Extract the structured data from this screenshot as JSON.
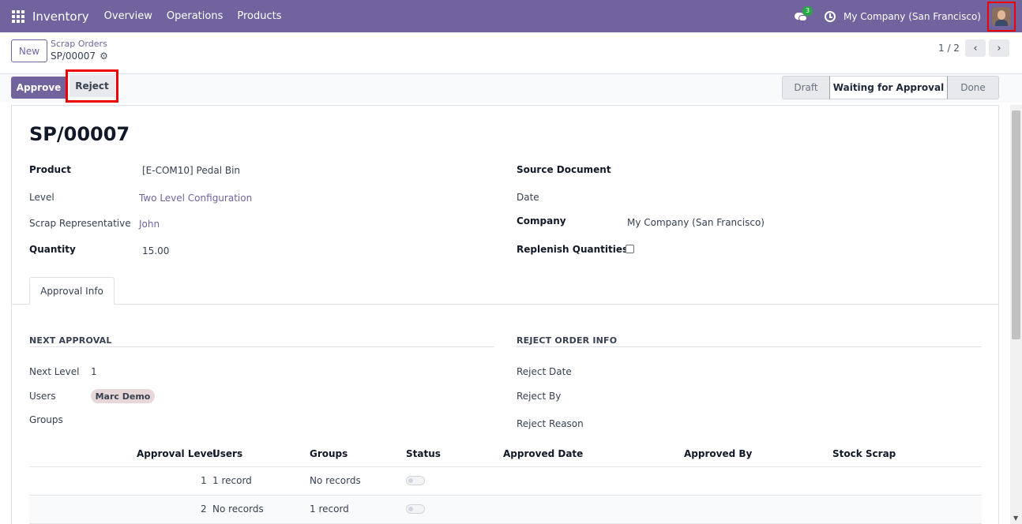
{
  "navbar": {
    "app_name": "Inventory",
    "menu": [
      "Overview",
      "Operations",
      "Products"
    ],
    "chat_badge": "3",
    "company": "My Company (San Francisco)",
    "color": "#71639e"
  },
  "control": {
    "new_label": "New",
    "breadcrumb_parent": "Scrap Orders",
    "breadcrumb_current": "SP/00007",
    "pager": "1 / 2"
  },
  "statusbar": {
    "approve_label": "Approve",
    "reject_label": "Reject",
    "stages": [
      "Draft",
      "Waiting for Approval",
      "Done"
    ],
    "active_stage": "Waiting for Approval"
  },
  "form": {
    "title": "SP/00007",
    "fields_left": {
      "product_label": "Product",
      "product_value": "[E-COM10] Pedal Bin",
      "level_label": "Level",
      "level_value": "Two Level Configuration",
      "rep_label": "Scrap Representative",
      "rep_value": "John",
      "qty_label": "Quantity",
      "qty_value": "15.00"
    },
    "fields_right": {
      "source_label": "Source Document",
      "date_label": "Date",
      "company_label": "Company",
      "company_value": "My Company (San Francisco)",
      "replenish_label": "Replenish Quantities",
      "replenish_checked": false
    },
    "tab_label": "Approval Info",
    "next_approval": {
      "title": "NEXT APPROVAL",
      "next_level_label": "Next Level",
      "next_level_value": "1",
      "users_label": "Users",
      "user_tag": "Marc Demo",
      "groups_label": "Groups"
    },
    "reject_info": {
      "title": "REJECT ORDER INFO",
      "reject_date_label": "Reject Date",
      "reject_by_label": "Reject By",
      "reject_reason_label": "Reject Reason"
    },
    "table": {
      "columns": [
        "Approval Level",
        "Users",
        "Groups",
        "Status",
        "Approved Date",
        "Approved By",
        "Stock Scrap"
      ],
      "rows": [
        {
          "level": "1",
          "users": "1 record",
          "groups": "No records"
        },
        {
          "level": "2",
          "users": "No records",
          "groups": "1 record"
        }
      ]
    }
  }
}
